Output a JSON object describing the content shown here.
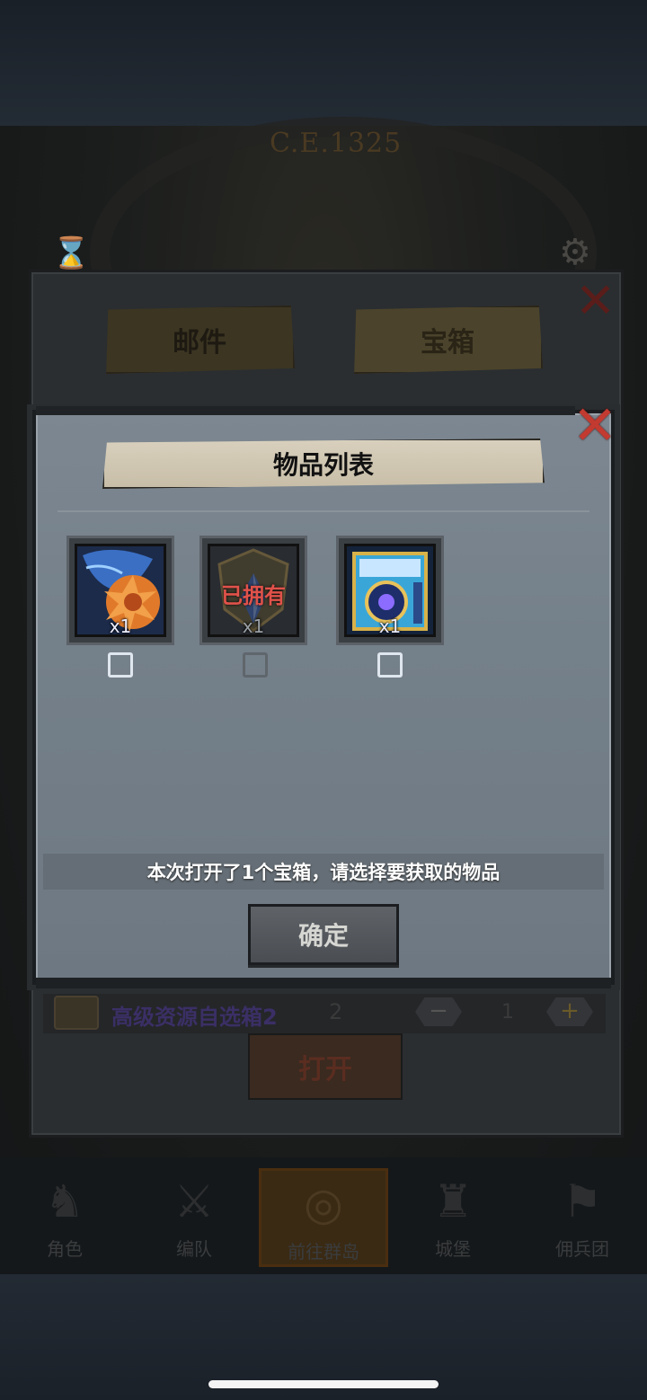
{
  "background": {
    "era_text": "C.E.1325"
  },
  "back_window": {
    "tabs": [
      {
        "label": "邮件",
        "active": false
      },
      {
        "label": "宝箱",
        "active": true
      }
    ],
    "chest_row": {
      "name": "高级资源自选箱2",
      "count": "2",
      "quantity": "1",
      "minus": "−",
      "plus": "+"
    },
    "open_button": "打开"
  },
  "bottom_nav": {
    "items": [
      {
        "label": "角色",
        "icon": "character-icon"
      },
      {
        "label": "编队",
        "icon": "formation-icon"
      },
      {
        "label": "前往群岛",
        "icon": "islands-icon",
        "active": true
      },
      {
        "label": "城堡",
        "icon": "castle-icon"
      },
      {
        "label": "佣兵团",
        "icon": "mercenary-icon"
      }
    ]
  },
  "modal": {
    "title": "物品列表",
    "items": [
      {
        "quantity": "x1",
        "owned": false,
        "checked": false,
        "icon": "dragon-shield-icon"
      },
      {
        "quantity": "x1",
        "owned": true,
        "owned_label": "已拥有",
        "checked": false,
        "icon": "crystal-shield-icon"
      },
      {
        "quantity": "x1",
        "owned": false,
        "checked": false,
        "icon": "magic-tome-icon"
      }
    ],
    "info_text": "本次打开了1个宝箱，请选择要获取的物品",
    "confirm_button": "确定"
  },
  "colors": {
    "close_red": "#c23a30",
    "owned_red": "#e0524a",
    "modal_bg": "#74808a"
  }
}
